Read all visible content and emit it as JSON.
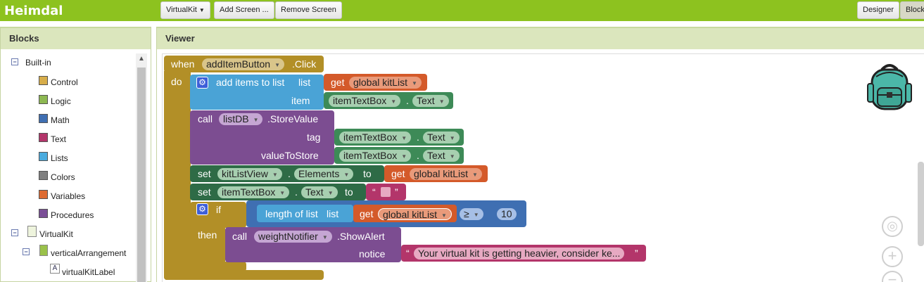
{
  "app": {
    "title": "Heimdal"
  },
  "toolbar": {
    "screen_select": "VirtualKit",
    "add_screen": "Add Screen ...",
    "remove_screen": "Remove Screen",
    "designer": "Designer",
    "blocks": "Blocks"
  },
  "sidebar": {
    "header": "Blocks",
    "builtin_label": "Built-in",
    "builtin": [
      {
        "label": "Control",
        "color": "#d7ad4a"
      },
      {
        "label": "Logic",
        "color": "#8db852"
      },
      {
        "label": "Math",
        "color": "#3f6fb2"
      },
      {
        "label": "Text",
        "color": "#b3356a"
      },
      {
        "label": "Lists",
        "color": "#4aabde"
      },
      {
        "label": "Colors",
        "color": "#7f7f7f"
      },
      {
        "label": "Variables",
        "color": "#de6b32"
      },
      {
        "label": "Procedures",
        "color": "#7a4e96"
      }
    ],
    "screen": "VirtualKit",
    "arrangement": "verticalArrangement",
    "label_component": "virtualKitLabel"
  },
  "viewer": {
    "header": "Viewer"
  },
  "blocks": {
    "event": {
      "when": "when",
      "component": "addItemButton",
      "event": ".Click",
      "do": "do"
    },
    "add_items": {
      "label": "add items to list",
      "list": "list",
      "item": "item",
      "get": "get",
      "var": "global kitList",
      "comp": "itemTextBox",
      "dot": ".",
      "prop": "Text"
    },
    "store": {
      "call": "call",
      "comp": "listDB",
      "method": ".StoreValue",
      "tag": "tag",
      "value": "valueToStore",
      "c1": "itemTextBox",
      "p1": "Text",
      "c2": "itemTextBox",
      "p2": "Text",
      "dot": "."
    },
    "set1": {
      "set": "set",
      "comp": "kitListView",
      "prop": "Elements",
      "to": "to",
      "get": "get",
      "var": "global kitList",
      "dot": "."
    },
    "set2": {
      "set": "set",
      "comp": "itemTextBox",
      "prop": "Text",
      "to": "to",
      "open_q": "“",
      "close_q": "”",
      "dot": "."
    },
    "if": {
      "if": "if",
      "then": "then",
      "length": "length of list",
      "list": "list",
      "get": "get",
      "var": "global kitList",
      "op": "≥",
      "num": "10"
    },
    "alert": {
      "call": "call",
      "comp": "weightNotifier",
      "method": ".ShowAlert",
      "notice": "notice",
      "text": "Your virtual kit is getting heavier, consider ke...",
      "open_q": "“",
      "close_q": "”"
    }
  }
}
